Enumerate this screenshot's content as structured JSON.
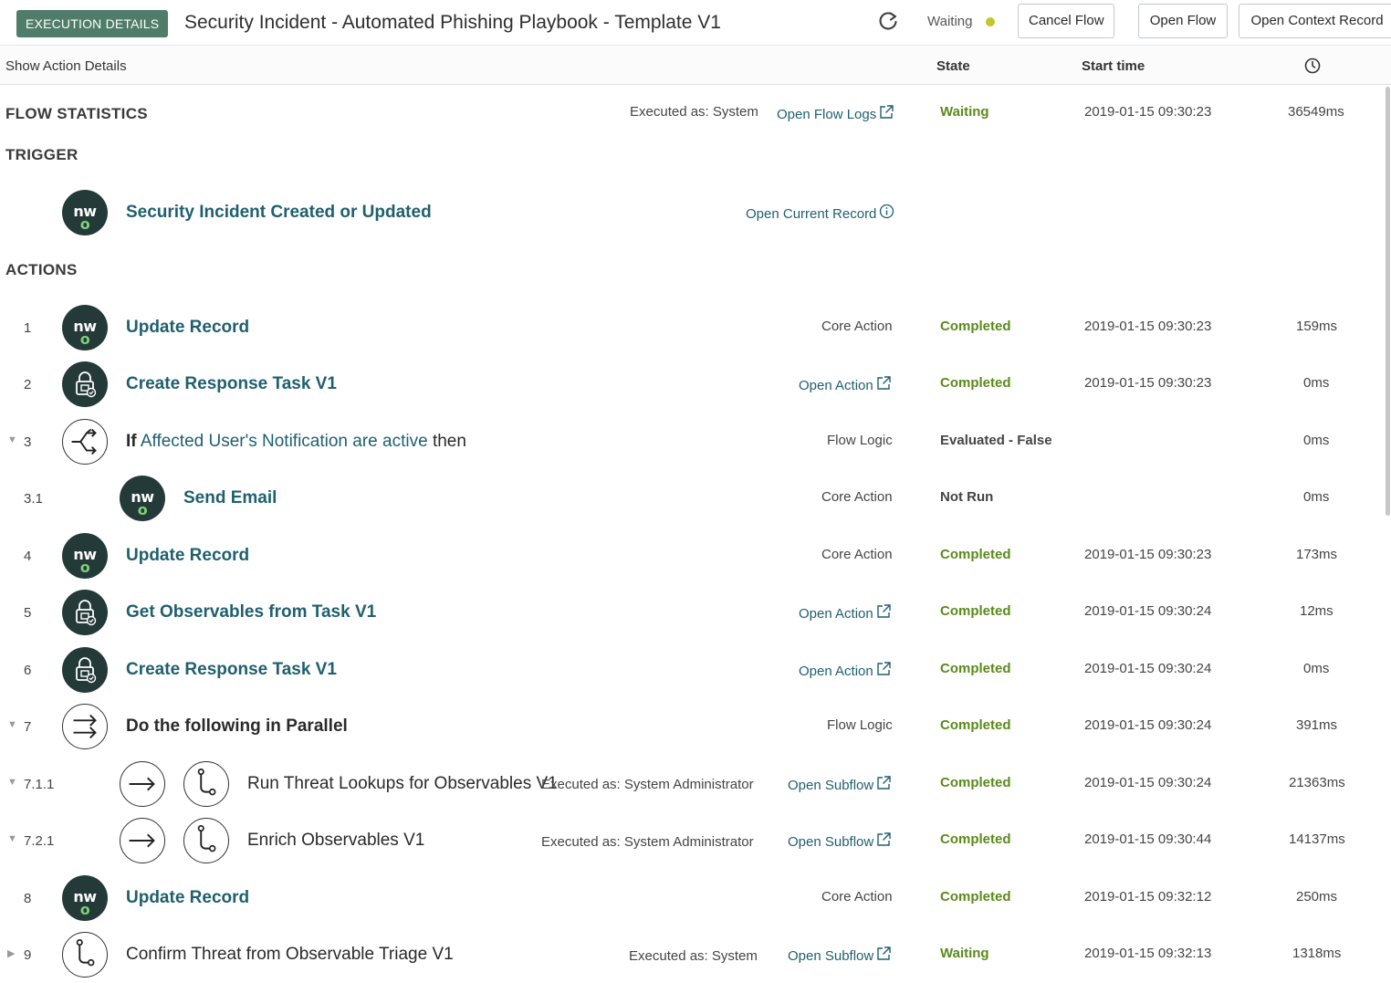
{
  "header": {
    "badge": "EXECUTION DETAILS",
    "title": "Security Incident - Automated Phishing Playbook - Template V1",
    "status": "Waiting",
    "status_color": "#c6c52a",
    "cancel_label": "Cancel Flow",
    "open_flow_label": "Open Flow",
    "open_context_label": "Open Context Record"
  },
  "columns": {
    "show_details": "Show Action Details",
    "state": "State",
    "start_time": "Start time",
    "duration_icon": "clock-icon"
  },
  "flow_statistics": {
    "label": "FLOW STATISTICS",
    "executed_as": "Executed as: System",
    "open_logs": "Open Flow Logs",
    "state": "Waiting",
    "start": "2019-01-15 09:30:23",
    "duration": "36549ms"
  },
  "trigger": {
    "label": "TRIGGER",
    "name": "Security Incident Created or Updated",
    "open_record": "Open Current Record",
    "icon": "now-logo-icon"
  },
  "actions_label": "ACTIONS",
  "actions": [
    {
      "num": "1",
      "name": "Update Record",
      "type": "Core Action",
      "state": "Completed",
      "start": "2019-01-15 09:30:23",
      "duration": "159ms"
    },
    {
      "num": "2",
      "name": "Create Response Task V1",
      "link": "Open Action",
      "state": "Completed",
      "start": "2019-01-15 09:30:23",
      "duration": "0ms"
    },
    {
      "num": "3",
      "prefix": "If",
      "name": "Affected User's Notification are active",
      "suffix": "then",
      "type": "Flow Logic",
      "state": "Evaluated - False",
      "duration": "0ms"
    },
    {
      "num": "3.1",
      "name": "Send Email",
      "type": "Core Action",
      "state": "Not Run",
      "duration": "0ms"
    },
    {
      "num": "4",
      "name": "Update Record",
      "type": "Core Action",
      "state": "Completed",
      "start": "2019-01-15 09:30:23",
      "duration": "173ms"
    },
    {
      "num": "5",
      "name": "Get Observables from Task V1",
      "link": "Open Action",
      "state": "Completed",
      "start": "2019-01-15 09:30:24",
      "duration": "12ms"
    },
    {
      "num": "6",
      "name": "Create Response Task V1",
      "link": "Open Action",
      "state": "Completed",
      "start": "2019-01-15 09:30:24",
      "duration": "0ms"
    },
    {
      "num": "7",
      "name": "Do the following in Parallel",
      "type": "Flow Logic",
      "state": "Completed",
      "start": "2019-01-15 09:30:24",
      "duration": "391ms"
    },
    {
      "num": "7.1.1",
      "name": "Run Threat Lookups for Observables V1",
      "executed_as": "Executed as: System Administrator",
      "link": "Open Subflow",
      "state": "Completed",
      "start": "2019-01-15 09:30:24",
      "duration": "21363ms"
    },
    {
      "num": "7.2.1",
      "name": "Enrich Observables V1",
      "executed_as": "Executed as: System Administrator",
      "link": "Open Subflow",
      "state": "Completed",
      "start": "2019-01-15 09:30:44",
      "duration": "14137ms"
    },
    {
      "num": "8",
      "name": "Update Record",
      "type": "Core Action",
      "state": "Completed",
      "start": "2019-01-15 09:32:12",
      "duration": "250ms"
    },
    {
      "num": "9",
      "name": "Confirm Threat from Observable Triage V1",
      "executed_as": "Executed as: System",
      "link": "Open Subflow",
      "state": "Waiting",
      "start": "2019-01-15 09:32:13",
      "duration": "1318ms"
    }
  ],
  "colors": {
    "badge_bg": "#4f7d6a",
    "link": "#1f5f6e",
    "state_green": "#5a8a1a",
    "icon_dark": "#243a38"
  }
}
